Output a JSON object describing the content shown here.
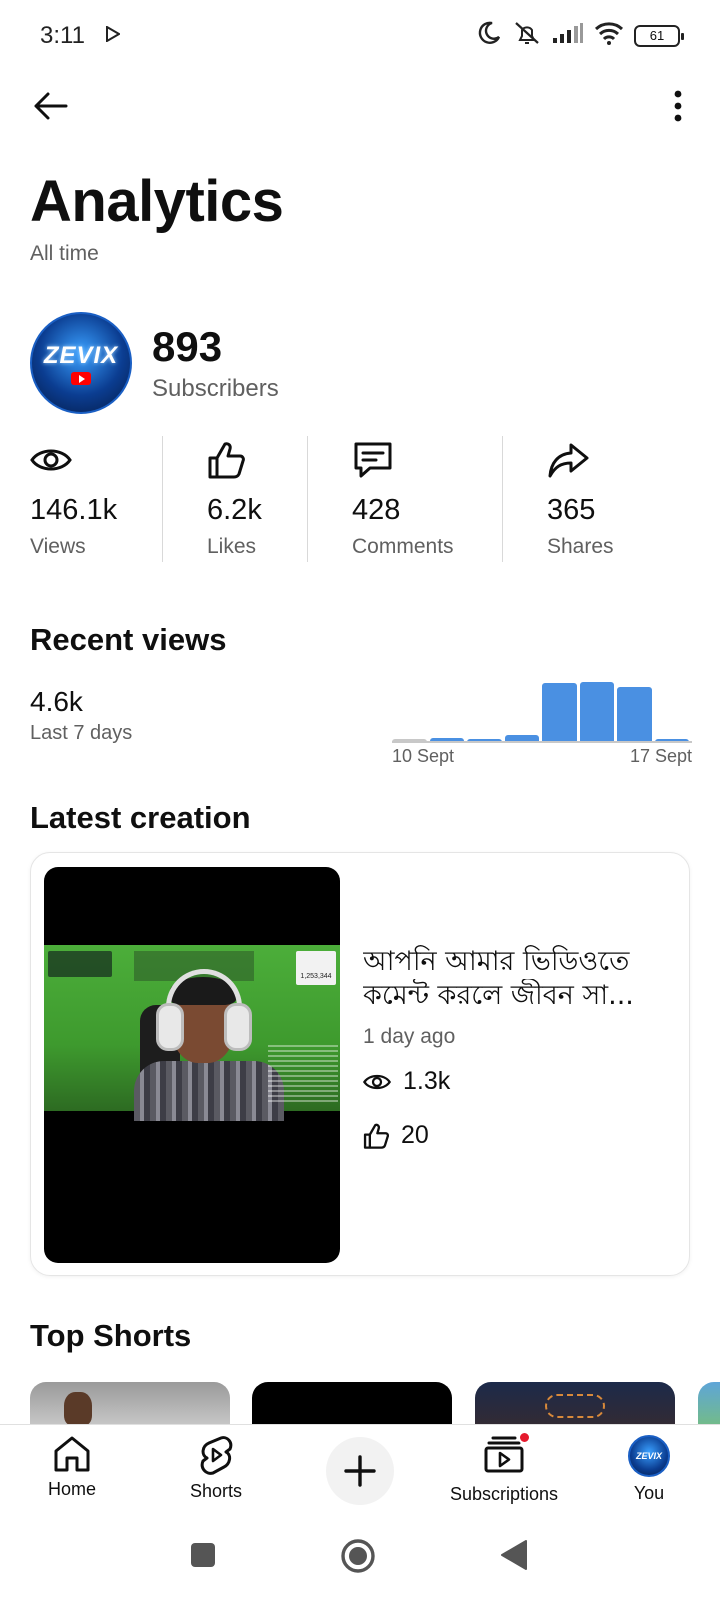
{
  "status_bar": {
    "time": "3:11",
    "battery": "61"
  },
  "header": {
    "back_icon": "arrow-left-icon",
    "more_icon": "more-vertical-icon"
  },
  "page": {
    "title": "Analytics",
    "subtitle": "All time"
  },
  "channel": {
    "avatar_text": "ZEVIX",
    "subscribers_value": "893",
    "subscribers_label": "Subscribers"
  },
  "stats": [
    {
      "icon": "eye-icon",
      "value": "146.1k",
      "label": "Views"
    },
    {
      "icon": "thumbs-up-icon",
      "value": "6.2k",
      "label": "Likes"
    },
    {
      "icon": "comment-icon",
      "value": "428",
      "label": "Comments"
    },
    {
      "icon": "share-icon",
      "value": "365",
      "label": "Shares"
    }
  ],
  "recent_views": {
    "title": "Recent views",
    "value": "4.6k",
    "period": "Last 7 days",
    "start_label": "10 Sept",
    "end_label": "17 Sept",
    "bar_color": "#4a90e2",
    "muted_bar_color": "#c8c8c8",
    "relative_values": [
      0.03,
      0.06,
      0.04,
      0.12,
      1.0,
      1.02,
      0.94,
      0.04
    ]
  },
  "latest_creation": {
    "section_title": "Latest creation",
    "title_line1": "আপনি আমার ভিডিওতে",
    "title_line2": "কমেন্ট করলে জীবন সা...",
    "age": "1 day ago",
    "views": "1.3k",
    "likes": "20",
    "thumb_badge": "1,253,344"
  },
  "top_shorts": {
    "title": "Top Shorts"
  },
  "bottom_nav": {
    "home": "Home",
    "shorts": "Shorts",
    "subscriptions": "Subscriptions",
    "you": "You"
  },
  "colors": {
    "accent": "#4a90e2",
    "notification": "#e5192d",
    "muted_text": "#606060"
  }
}
